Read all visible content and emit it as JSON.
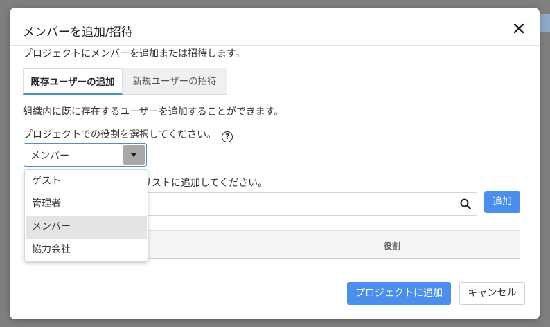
{
  "modal": {
    "title": "メンバーを追加/招待",
    "description": "プロジェクトにメンバーを追加または招待します。",
    "tabs": [
      {
        "label": "既存ユーザーの追加",
        "active": true
      },
      {
        "label": "新規ユーザーの招待",
        "active": false
      }
    ],
    "info_text": "組織内に既に存在するユーザーを追加することができます。",
    "role_prompt": "プロジェクトでの役割を選択してください。",
    "role_select": {
      "value": "メンバー",
      "options": [
        "ゲスト",
        "管理者",
        "メンバー",
        "協力会社"
      ]
    },
    "list_prompt_partial": "リストに追加してください。",
    "search": {
      "placeholder": ""
    },
    "add_button": "追加",
    "table": {
      "col_role": "役割"
    },
    "footer": {
      "primary": "プロジェクトに追加",
      "cancel": "キャンセル"
    }
  },
  "colors": {
    "accent": "#4a8ff0",
    "overlay": "#7f7f7f"
  }
}
